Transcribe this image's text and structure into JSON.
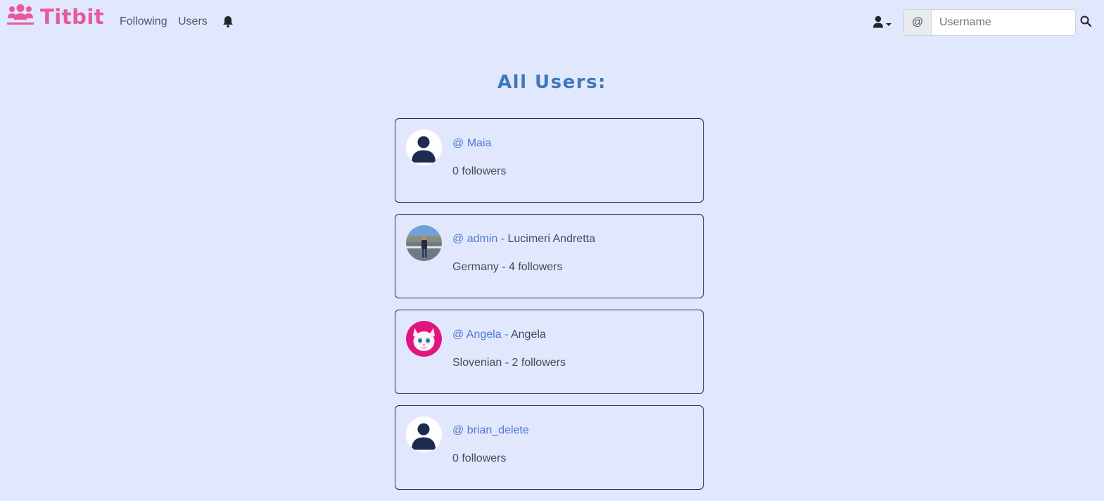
{
  "navbar": {
    "brand": "Titbit",
    "links": [
      {
        "label": "Following"
      },
      {
        "label": "Users"
      }
    ],
    "search": {
      "prefix": "@",
      "placeholder": "Username",
      "value": ""
    }
  },
  "main": {
    "title": "All Users:",
    "users": [
      {
        "handle": "@ Maia",
        "name": "",
        "line2": "0 followers",
        "avatar": "default-avatar"
      },
      {
        "handle": "@ admin",
        "name": "Lucimeri Andretta",
        "line2": "Germany - 4 followers",
        "avatar": "photo-avatar"
      },
      {
        "handle": "@ Angela",
        "name": "Angela",
        "line2": "Slovenian - 2 followers",
        "avatar": "cat-avatar"
      },
      {
        "handle": "@ brian_delete",
        "name": "",
        "line2": "0 followers",
        "avatar": "default-avatar"
      }
    ]
  },
  "colors": {
    "background": "#e1e7fc",
    "brand": "#e65a9a",
    "title": "#3d78bd",
    "link": "#4e7bd6",
    "card_border": "#1f2d50"
  }
}
